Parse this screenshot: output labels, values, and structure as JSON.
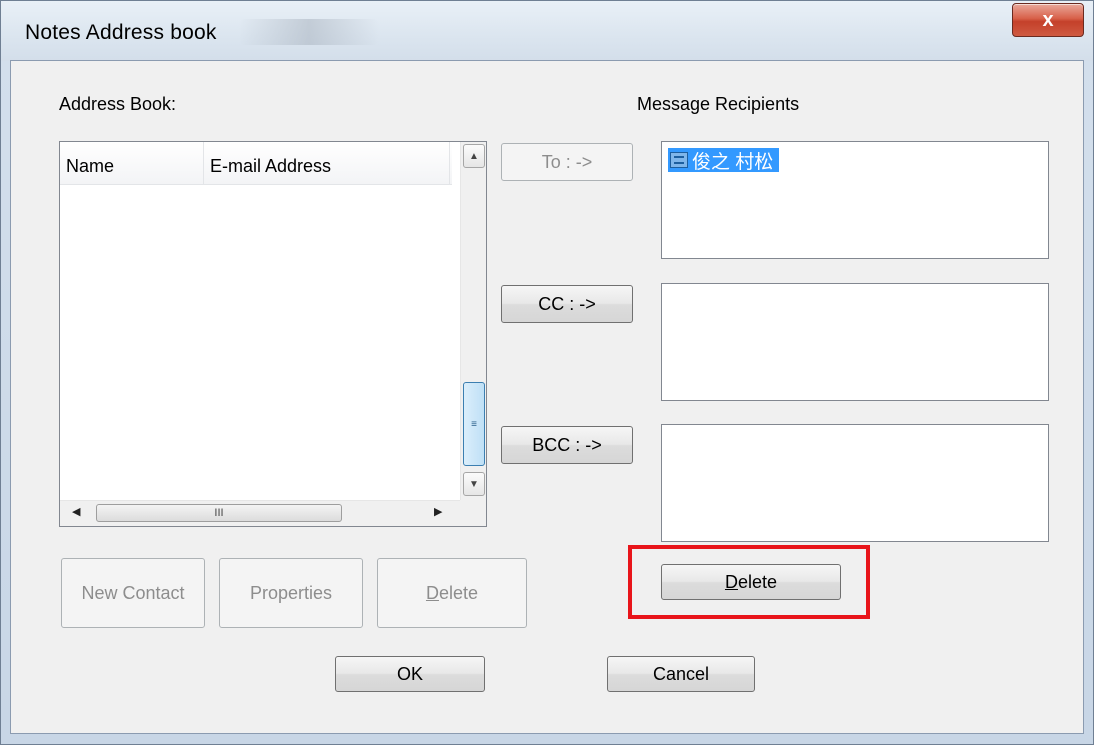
{
  "window": {
    "title": "Notes Address book",
    "close_glyph": "x"
  },
  "address_book": {
    "label": "Address Book:",
    "columns": [
      "Name",
      "E-mail Address"
    ],
    "hscroll_grip": "III",
    "vscroll_grip": "≡"
  },
  "transfer": {
    "to_label": "To : ->",
    "cc_label": "CC : ->",
    "bcc_label": "BCC : ->"
  },
  "recipients": {
    "label": "Message Recipients",
    "to": [
      "俊之 村松"
    ],
    "cc": [],
    "bcc": []
  },
  "contact_buttons": {
    "new_contact": "New Contact",
    "properties": "Properties",
    "delete_prefix": "D",
    "delete_rest": "elete"
  },
  "recipient_delete": {
    "prefix": "D",
    "rest": "elete"
  },
  "footer": {
    "ok_label": "OK",
    "cancel_label": "Cancel"
  },
  "colors": {
    "highlight": "#e8141a",
    "selection": "#3399ff"
  }
}
